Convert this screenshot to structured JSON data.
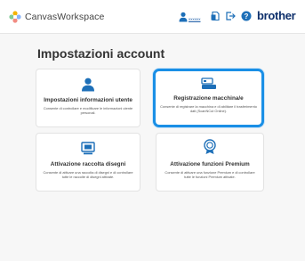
{
  "header": {
    "app_name": "CanvasWorkspace",
    "user_name": "xxxxxx",
    "brand": "brother",
    "icons": [
      "app-logo-icon",
      "user-icon",
      "document-icon",
      "logout-icon",
      "help-icon"
    ]
  },
  "main": {
    "title": "Impostazioni account",
    "cards": [
      {
        "icon": "user-icon",
        "title": "Impostazioni informazioni utente",
        "description": "Consente di controllare e modificare le informazioni utente personali.",
        "selected": false
      },
      {
        "icon": "machine-icon",
        "title": "Registrazione macchina/e",
        "description": "Consente di registrare la macchina e di abilitare il trasferimento dati (ScanNCut Online).",
        "selected": true
      },
      {
        "icon": "pattern-collection-icon",
        "title": "Attivazione raccolta disegni",
        "description": "Consente di attivare una raccolta di disegni e di controllare tutte le raccolte di disegni attivate.",
        "selected": false
      },
      {
        "icon": "premium-badge-icon",
        "title": "Attivazione funzioni Premium",
        "description": "Consente di attivare una funzione Premium e di controllare tutte le funzioni Premium attivate.",
        "selected": false
      }
    ]
  },
  "colors": {
    "accent": "#1a8fe6",
    "icon": "#1d6fb8",
    "brand": "#0d2f6b",
    "background": "#f7f7f7"
  }
}
